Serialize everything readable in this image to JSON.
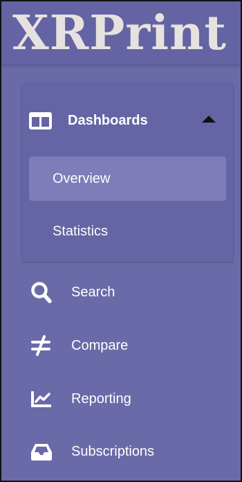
{
  "app": {
    "logo_text": "XRPrint"
  },
  "sidebar": {
    "group": {
      "label": "Dashboards",
      "icon": "columns-icon",
      "expanded": true,
      "items": [
        {
          "label": "Overview",
          "active": true
        },
        {
          "label": "Statistics",
          "active": false
        }
      ]
    },
    "items": [
      {
        "label": "Search",
        "icon": "search-icon"
      },
      {
        "label": "Compare",
        "icon": "not-equal-icon"
      },
      {
        "label": "Reporting",
        "icon": "chart-line-icon"
      },
      {
        "label": "Subscriptions",
        "icon": "inbox-icon"
      }
    ]
  },
  "colors": {
    "sidebar_bg": "#6b6aa8",
    "group_bg": "#6564a4",
    "active_item_bg": "#7e7db9",
    "logo_text": "#e6e2df",
    "text": "#ffffff"
  }
}
